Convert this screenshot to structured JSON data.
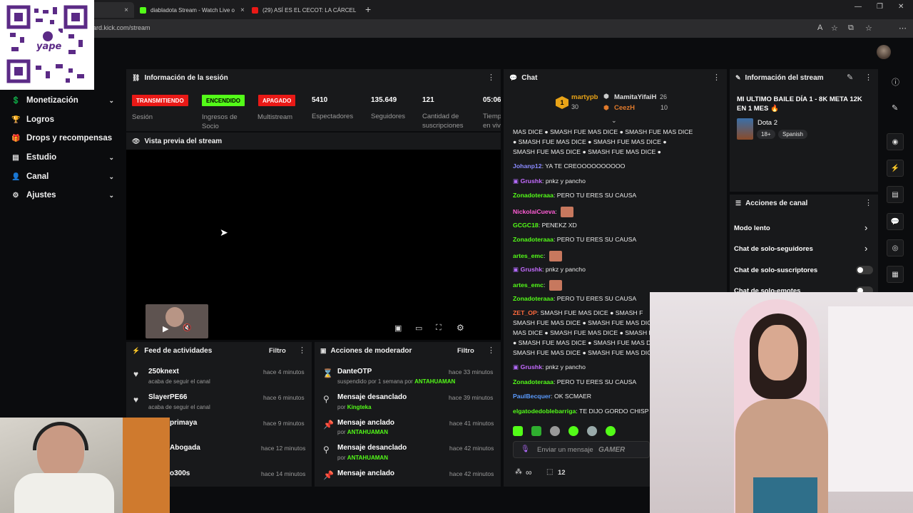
{
  "browser": {
    "tabs": [
      {
        "title": "diabladota Stream - Watch Live o",
        "close": "×"
      },
      {
        "title": "(29) ASÍ ES EL CECOT: LA CÁRCEL",
        "close": "×"
      }
    ],
    "active_tab_partial": "d",
    "active_tab_close": "×",
    "new_tab": "+",
    "url": "ard.kick.com/stream",
    "window_controls": [
      "—",
      "❐",
      "✕"
    ]
  },
  "sidebar": {
    "items": [
      {
        "label": "Monetización",
        "icon": "dollar-icon",
        "glyph": "💲",
        "chev": "⌄"
      },
      {
        "label": "Logros",
        "icon": "trophy-icon",
        "glyph": "🏆",
        "chev": ""
      },
      {
        "label": "Drops y recompensas",
        "icon": "gift-icon",
        "glyph": "🎁",
        "chev": ""
      },
      {
        "label": "Estudio",
        "icon": "layers-icon",
        "glyph": "▤",
        "chev": "⌄"
      },
      {
        "label": "Canal",
        "icon": "person-icon",
        "glyph": "👤",
        "chev": "⌄"
      },
      {
        "label": "Ajustes",
        "icon": "gear-icon",
        "glyph": "⚙",
        "chev": "⌄"
      }
    ]
  },
  "session": {
    "title": "Información de la sesión",
    "menu": "⋮",
    "stats": [
      {
        "badge": "TRANSMITIENDO",
        "label": "Sesión"
      },
      {
        "badge": "ENCENDIDO",
        "label": "Ingresos de Socio"
      },
      {
        "badge": "APAGADO",
        "label": "Multistream"
      },
      {
        "value": "5410",
        "label": "Espectadores"
      },
      {
        "value": "135.649",
        "label": "Seguidores"
      },
      {
        "value": "121",
        "label": "Cantidad de suscripciones"
      },
      {
        "value": "05:06",
        "label": "Tiemp en viv"
      }
    ]
  },
  "preview": {
    "title": "Vista previa del stream"
  },
  "activity": {
    "title": "Feed de actividades",
    "filter": "Filtro",
    "menu": "⋮",
    "items": [
      {
        "name": "250knext",
        "sub": "acaba de seguir el canal",
        "time": "hace 4 minutos"
      },
      {
        "name": "SlayerPE66",
        "sub": "acaba de seguir el canal",
        "time": "hace 6 minutos"
      },
      {
        "name": "primaya",
        "sub": "",
        "time": "hace 9 minutos"
      },
      {
        "name": "Abogada",
        "sub": "",
        "time": "hace 12 minutos"
      },
      {
        "name": "o300s",
        "sub": "",
        "time": "hace 14 minutos"
      }
    ]
  },
  "modactions": {
    "title": "Acciones de moderador",
    "filter": "Filtro",
    "menu": "⋮",
    "items": [
      {
        "title": "DanteOTP",
        "sub": "suspendido por 1 semana por",
        "by": "ANTAHUAMAN",
        "time": "hace 33 minutos",
        "icon": "hourglass-icon",
        "glyph": "⌛"
      },
      {
        "title": "Mensaje desanclado",
        "sub": "por",
        "by": "Kingteka",
        "time": "hace 39 minutos",
        "icon": "unpin-icon",
        "glyph": "⚲"
      },
      {
        "title": "Mensaje anclado",
        "sub": "por",
        "by": "ANTAHUAMAN",
        "time": "hace 41 minutos",
        "icon": "pin-icon",
        "glyph": "📌"
      },
      {
        "title": "Mensaje desanclado",
        "sub": "por",
        "by": "ANTAHUAMAN",
        "time": "hace 42 minutos",
        "icon": "unpin-icon",
        "glyph": "⚲"
      },
      {
        "title": "Mensaje anclado",
        "sub": "",
        "by": "",
        "time": "hace 42 minutos",
        "icon": "pin-icon",
        "glyph": "📌"
      }
    ]
  },
  "chat": {
    "title": "Chat",
    "menu": "⋮",
    "leaderboard": {
      "first": {
        "rank": "1",
        "name": "martypb",
        "count": "30"
      },
      "second": {
        "name": "MamitaYifaiH",
        "count": "26"
      },
      "third": {
        "name": "CeezH",
        "count": "10"
      }
    },
    "messages": [
      {
        "user": "",
        "text": "MAS DICE ● SMASH FUE MAS DICE ● SMASH FUE MAS DICE",
        "color": "#e9e9e9"
      },
      {
        "user": "",
        "text": "● SMASH FUE MAS DICE ● SMASH FUE MAS DICE ●",
        "color": "#e9e9e9"
      },
      {
        "user": "",
        "text": "SMASH FUE MAS DICE ● SMASH FUE MAS DICE ●",
        "color": "#e9e9e9"
      },
      {
        "user": "Johanp12",
        "text": "YA TE CREOOOOOOOOOO",
        "color": "#8a8aff"
      },
      {
        "user": "Grushk",
        "text": "pnkz y pancho",
        "color": "#c46bff"
      },
      {
        "user": "Zonadoteraaa",
        "text": "PERO TU ERES SU CAUSA",
        "color": "#53fc18"
      },
      {
        "user": "NickolaiCueva",
        "text": "",
        "color": "#ff5dd6"
      },
      {
        "user": "GCGC18",
        "text": "PENEKZ XD",
        "color": "#53fc18"
      },
      {
        "user": "Zonadoteraaa",
        "text": "PERO TU ERES SU CAUSA",
        "color": "#53fc18"
      },
      {
        "user": "artes_emc",
        "text": "",
        "color": "#53fc18"
      },
      {
        "user": "Grushk",
        "text": "pnkz y pancho",
        "color": "#c46bff"
      },
      {
        "user": "artes_emc",
        "text": "",
        "color": "#53fc18"
      },
      {
        "user": "Zonadoteraaa",
        "text": "PERO TU ERES SU CAUSA",
        "color": "#53fc18"
      },
      {
        "user": "ZET_OP",
        "text": "SMASH FUE MAS DICE ● SMASH F",
        "color": "#ff6a3d"
      },
      {
        "user": "",
        "text": "SMASH FUE MAS DICE ● SMASH FUE MAS DICE ● SM",
        "color": "#e9e9e9"
      },
      {
        "user": "",
        "text": "MAS DICE ● SMASH FUE MAS DICE ● SMASH FUE MAS DICE ● SM",
        "color": "#e9e9e9"
      },
      {
        "user": "",
        "text": "● SMASH FUE MAS DICE ● SMASH FUE MAS DICE ● SM",
        "color": "#e9e9e9"
      },
      {
        "user": "",
        "text": "SMASH FUE MAS DICE ● SMASH FUE MAS DICE ● SM",
        "color": "#e9e9e9"
      },
      {
        "user": "Grushk",
        "text": "pnkz y pancho",
        "color": "#c46bff"
      },
      {
        "user": "Zonadoteraaa",
        "text": "PERO TU ERES SU CAUSA",
        "color": "#53fc18"
      },
      {
        "user": "PaulBecquer",
        "text": "OK SCMAER",
        "color": "#5a9bff"
      },
      {
        "user": "elgatodedoblebarriga",
        "text": "TE DIJO GORDO CHISP",
        "color": "#53fc18"
      }
    ],
    "input_placeholder": "Enviar un mensaje",
    "watermark": "GAMER",
    "infinity": "∞",
    "count": "12"
  },
  "streaminfo": {
    "title": "Información del stream",
    "stream_title": "MI ULTIMO BAILE DÍA 1 - 8K META 12K EN 1 MES 🔥",
    "category": "Dota 2",
    "tags": [
      "18+",
      "Spanish"
    ],
    "menu": "⋮",
    "edit": "✎"
  },
  "channelactions": {
    "title": "Acciones de canal",
    "menu": "⋮",
    "items": [
      {
        "label": "Modo lento",
        "type": "arrow"
      },
      {
        "label": "Chat de solo-seguidores",
        "type": "arrow"
      },
      {
        "label": "Chat de solo-suscriptores",
        "type": "toggle"
      },
      {
        "label": "Chat de solo-emotes",
        "type": "toggle"
      }
    ]
  },
  "qr": {
    "brand": "yape"
  },
  "colors": {
    "accent": "#53fc18",
    "live": "#e91916",
    "panel": "#18191b",
    "bg": "#0b0c0e"
  }
}
